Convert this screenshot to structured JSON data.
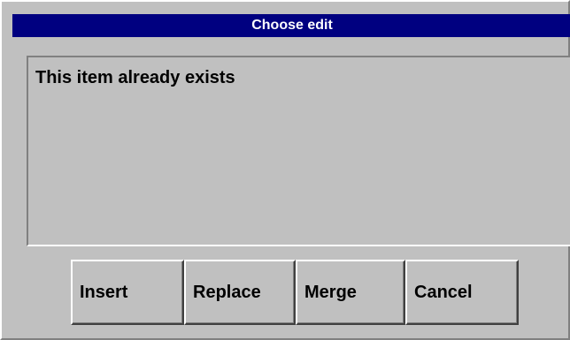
{
  "dialog": {
    "title": "Choose edit",
    "message": "This item already exists",
    "colors": {
      "titlebar_bg": "#000080",
      "titlebar_fg": "#ffffff",
      "face": "#c0c0c0"
    }
  },
  "buttons": {
    "insert": "Insert",
    "replace": "Replace",
    "merge": "Merge",
    "cancel": "Cancel"
  }
}
